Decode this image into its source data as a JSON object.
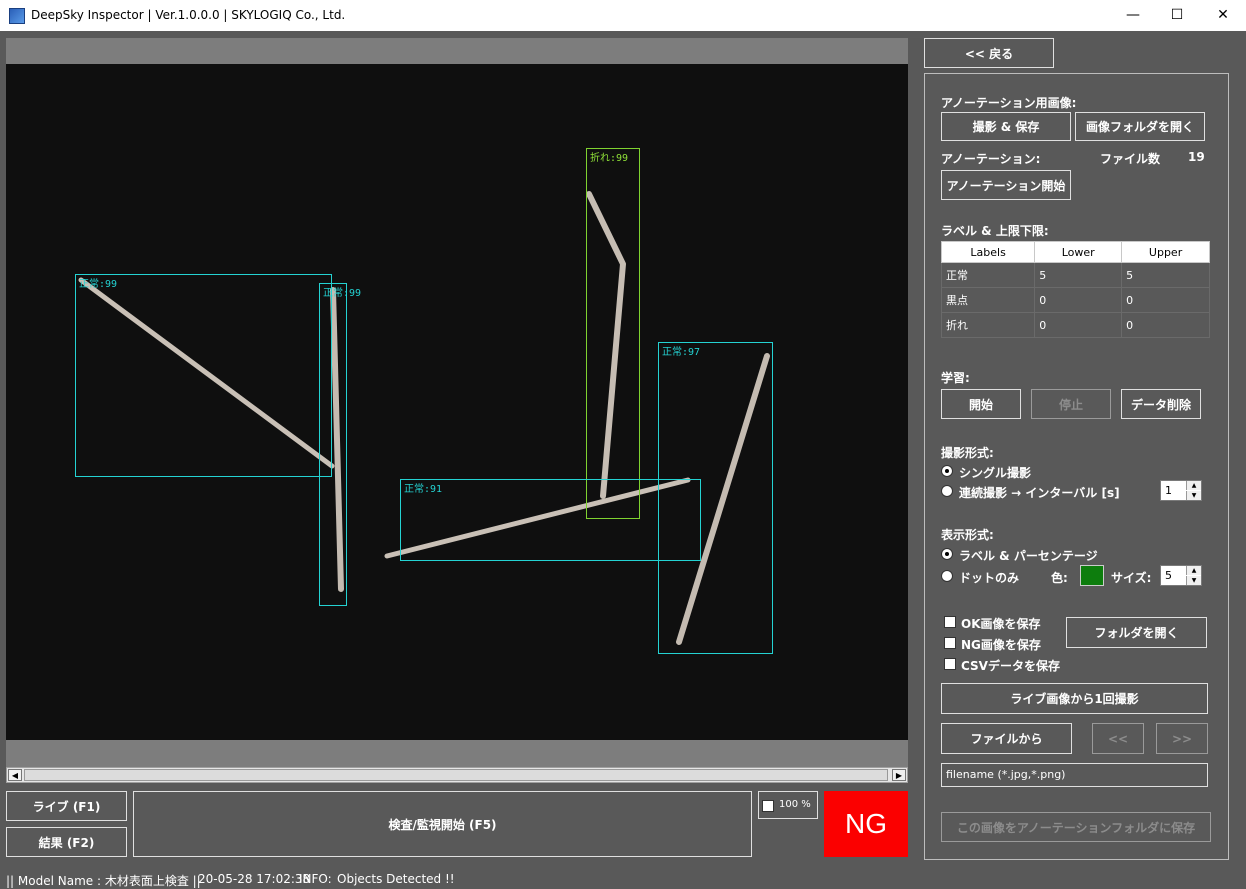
{
  "window": {
    "title": "DeepSky Inspector | Ver.1.0.0.0 | SKYLOGIQ Co., Ltd.",
    "minimize": "—",
    "maximize": "☐",
    "close": "✕"
  },
  "detections": [
    {
      "label": "正常:99",
      "color": "#24d2d2"
    },
    {
      "label": "正常:99",
      "color": "#24d2d2"
    },
    {
      "label": "折れ:99",
      "color": "#7fd230"
    },
    {
      "label": "正常:97",
      "color": "#24d2d2"
    },
    {
      "label": "正常:91",
      "color": "#24d2d2"
    }
  ],
  "bottom": {
    "live_button": "ライブ (F1)",
    "result_button": "結果 (F2)",
    "inspect_button": "検査/監視開始 (F5)",
    "zoom_value": "100 %",
    "judgement": "NG"
  },
  "status": {
    "model": "|| Model Name : 木材表面上検査 ||",
    "datetime": "20-05-28 17:02:38",
    "info_label": "INFO:",
    "info_text": "Objects Detected !!"
  },
  "panel": {
    "back_button": "<< 戻る",
    "annotation_image_heading": "アノーテーション用画像:",
    "capture_save_button": "撮影 & 保存",
    "open_image_folder_button": "画像フォルダを開く",
    "annotation_heading": "アノーテーション:",
    "file_count_label": "ファイル数",
    "file_count": "19",
    "annotation_start_button": "アノーテーション開始",
    "label_limits_heading": "ラベル & 上限下限:",
    "table": {
      "headers": [
        "Labels",
        "Lower",
        "Upper"
      ],
      "rows": [
        [
          "正常",
          "5",
          "5"
        ],
        [
          "黒点",
          "0",
          "0"
        ],
        [
          "折れ",
          "0",
          "0"
        ]
      ]
    },
    "learning_heading": "学習:",
    "learn_start": "開始",
    "learn_stop": "停止",
    "data_delete": "データ削除",
    "capture_mode_heading": "撮影形式:",
    "single_capture": "シングル撮影",
    "continuous_capture": "連続撮影 → インターバル [s]",
    "interval_value": "1",
    "display_mode_heading": "表示形式:",
    "label_percentage": "ラベル & パーセンテージ",
    "dot_only": "ドットのみ",
    "color_label": "色:",
    "dot_color": "#0d7d0d",
    "size_label": "サイズ:",
    "size_value": "5",
    "save_ok": "OK画像を保存",
    "save_ng": "NG画像を保存",
    "save_csv": "CSVデータを保存",
    "open_folder_button": "フォルダを開く",
    "live_capture_button": "ライブ画像から1回撮影",
    "from_file_button": "ファイルから",
    "prev_button": "<<",
    "next_button": ">>",
    "filename_placeholder": "filename (*.jpg,*.png)",
    "save_to_annotation_button": "この画像をアノーテーションフォルダに保存"
  }
}
